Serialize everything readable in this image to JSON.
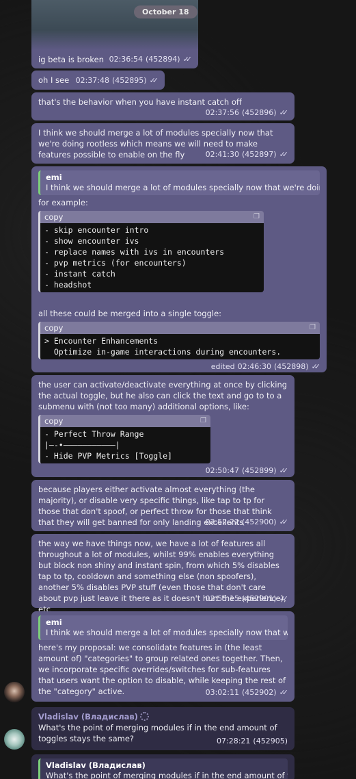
{
  "date_pill": "October 18",
  "messages": [
    {
      "text": "ig beta is broken",
      "time": "02:36:54",
      "id": "(452894)"
    },
    {
      "text": "oh I see",
      "time": "02:37:48",
      "id": "(452895)"
    },
    {
      "text": "that's the behavior when you have instant catch off",
      "time": "02:37:56",
      "id": "(452896)"
    },
    {
      "text": "I think we should merge a lot of modules specially now that we're doing rootless which means we will need to make features possible to enable on the fly",
      "time": "02:41:30",
      "id": "(452897)"
    },
    {
      "quote_name": "emi",
      "quote_text": "I think we should merge a lot of modules specially now that we're doin…",
      "intro": "for example:",
      "code1_label": "copy",
      "code1_lines": "- skip encounter intro\n- show encounter ivs\n- replace names with ivs in encounters\n- pvp metrics (for encounters)\n- instant catch\n- headshot",
      "middle": "all these could be merged into a single toggle:",
      "code2_label": "copy",
      "code2_lines": "> Encounter Enhancements\n  Optimize in-game interactions during encounters.",
      "edited": "edited",
      "time": "02:46:30",
      "id": "(452898)"
    },
    {
      "text": "the user can activate/deactivate everything at once by clicking the actual toggle, but he also can click the text and go to to a submenu with (not too many) additional options, like:",
      "code_label": "copy",
      "code_lines": "- Perfect Throw Range\n|—-•———————————|\n- Hide PVP Metrics [Toggle]",
      "time": "02:50:47",
      "id": "(452899)"
    },
    {
      "text": "because players either activate almost everything (the majority), or disable very specific things, like tap to tp for those that don't spoof, or perfect throw for those that think that they will get banned for only landing excellents",
      "time": "02:52:22",
      "id": "(452900)"
    },
    {
      "text": "the way we have things now, we have a lot of features all throughout a lot of modules, whilst 99% enables everything but block non shiny and instant spin, from which 5% disables tap to tp, cooldown and something else (non spoofers), another 5% disables PVP stuff (even those that don't care about pvp just leave it there as it doesn't hurt the experience), etc",
      "time": "02:55:15",
      "id": "(452901)"
    },
    {
      "quote_name": "emi",
      "quote_text": "I think we should merge a lot of modules specially now that we…",
      "text": "here's my proposal: we consolidate features in (the least amount of) \"categories\" to group related ones together. Then, we incorporate specific overrides/switches for sub-features that users want the option to disable, while keeping the rest of the \"category\" active.",
      "time": "03:02:11",
      "id": "(452902)"
    },
    {
      "sender": "Vladislav (Владислав)",
      "text": "What's the point of merging modules if in the end amount of toggles stays the same?",
      "time": "07:28:21",
      "id": "(452905)"
    },
    {
      "quote_name": "Vladislav (Владислав)",
      "quote_text": "What's the point of merging modules if in the end amount of t"
    }
  ],
  "ticks": "✓✓",
  "colors": {
    "bubble_out": "#5e5a84",
    "bubble_in": "#2f2c44",
    "quote_bar": "#7ccf7a",
    "background": "#161616"
  }
}
